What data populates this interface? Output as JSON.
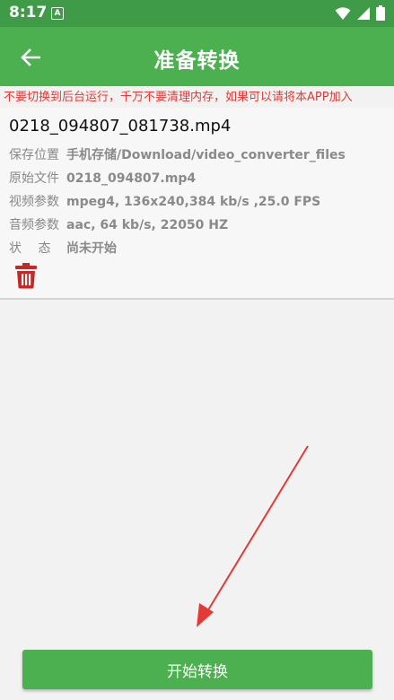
{
  "status_bar": {
    "time": "8:17",
    "notification_icon": "A"
  },
  "app_bar": {
    "title": "准备转换",
    "back_icon": "arrow-left-icon"
  },
  "warning_text": "不要切换到后台运行，千万不要清理内存，如果可以请将本APP加入",
  "file": {
    "name": "0218_094807_081738.mp4",
    "rows": [
      {
        "label": "保存位置",
        "value": "手机存储/Download/video_converter_files"
      },
      {
        "label": "原始文件",
        "value": "0218_094807.mp4"
      },
      {
        "label": "视频参数",
        "value": "mpeg4, 136x240,384 kb/s ,25.0 FPS"
      },
      {
        "label": "音频参数",
        "value": "aac, 64 kb/s, 22050 HZ"
      },
      {
        "label": "状　 态",
        "value": "尚未开始"
      }
    ]
  },
  "start_button": {
    "label": "开始转换"
  },
  "colors": {
    "primary": "#4caf50",
    "status_bar": "#3f9b47",
    "warning": "#e53935",
    "delete": "#c62828",
    "arrow": "#e53935"
  }
}
